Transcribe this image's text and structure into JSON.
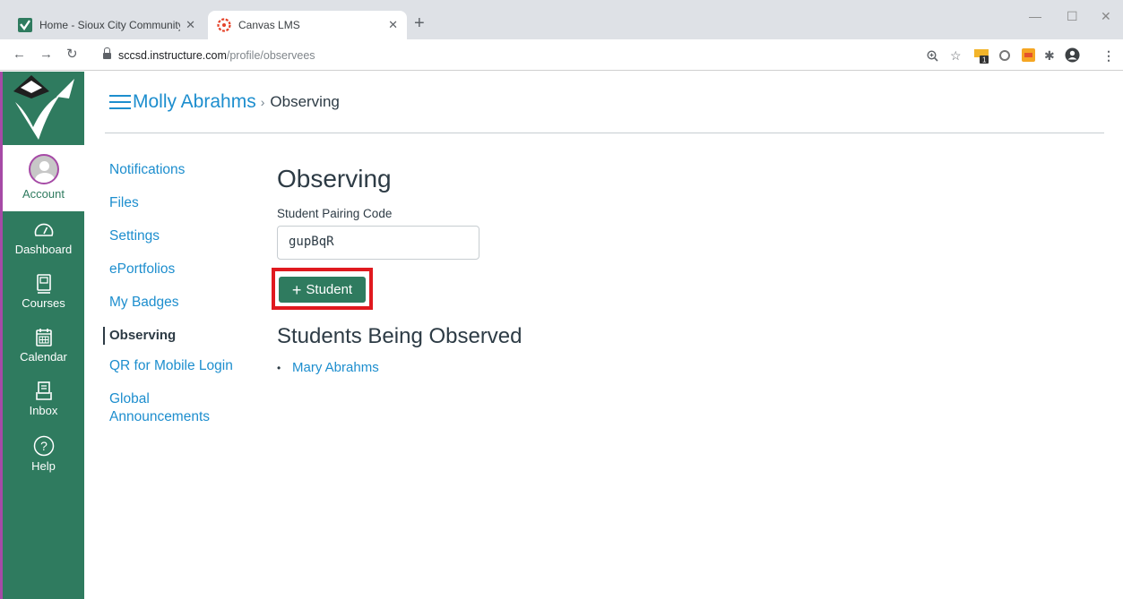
{
  "browser": {
    "tabs": [
      {
        "title": "Home - Sioux City Community Sc",
        "active": false
      },
      {
        "title": "Canvas LMS",
        "active": true
      }
    ],
    "new_tab": "+",
    "url_host": "sccsd.instructure.com",
    "url_path": "/profile/observees",
    "window_controls": {
      "minimize": "—",
      "maximize": "☐",
      "close": "✕"
    }
  },
  "global_nav": {
    "items": [
      {
        "label": "Account",
        "icon": "avatar-icon"
      },
      {
        "label": "Dashboard",
        "icon": "dashboard-icon"
      },
      {
        "label": "Courses",
        "icon": "courses-icon"
      },
      {
        "label": "Calendar",
        "icon": "calendar-icon"
      },
      {
        "label": "Inbox",
        "icon": "inbox-icon"
      },
      {
        "label": "Help",
        "icon": "help-icon"
      }
    ],
    "brand_color": "#2f7b5f"
  },
  "breadcrumb": {
    "user": "Molly Abrahms",
    "separator": "›",
    "current": "Observing"
  },
  "profile_nav": {
    "items": [
      {
        "label": "Notifications",
        "active": false
      },
      {
        "label": "Files",
        "active": false
      },
      {
        "label": "Settings",
        "active": false
      },
      {
        "label": "ePortfolios",
        "active": false
      },
      {
        "label": "My Badges",
        "active": false
      },
      {
        "label": "Observing",
        "active": true
      },
      {
        "label": "QR for Mobile Login",
        "active": false
      },
      {
        "label": "Global Announcements",
        "active": false
      }
    ]
  },
  "main": {
    "heading": "Observing",
    "pairing_label": "Student Pairing Code",
    "pairing_value": "gupBqR",
    "add_button": {
      "plus": "+",
      "label": "Student"
    },
    "observed_heading": "Students Being Observed",
    "observed_students": [
      "Mary Abrahms"
    ]
  },
  "colors": {
    "link": "#1d8ece",
    "highlight": "#e0191f",
    "account_border": "#a64aa6"
  }
}
